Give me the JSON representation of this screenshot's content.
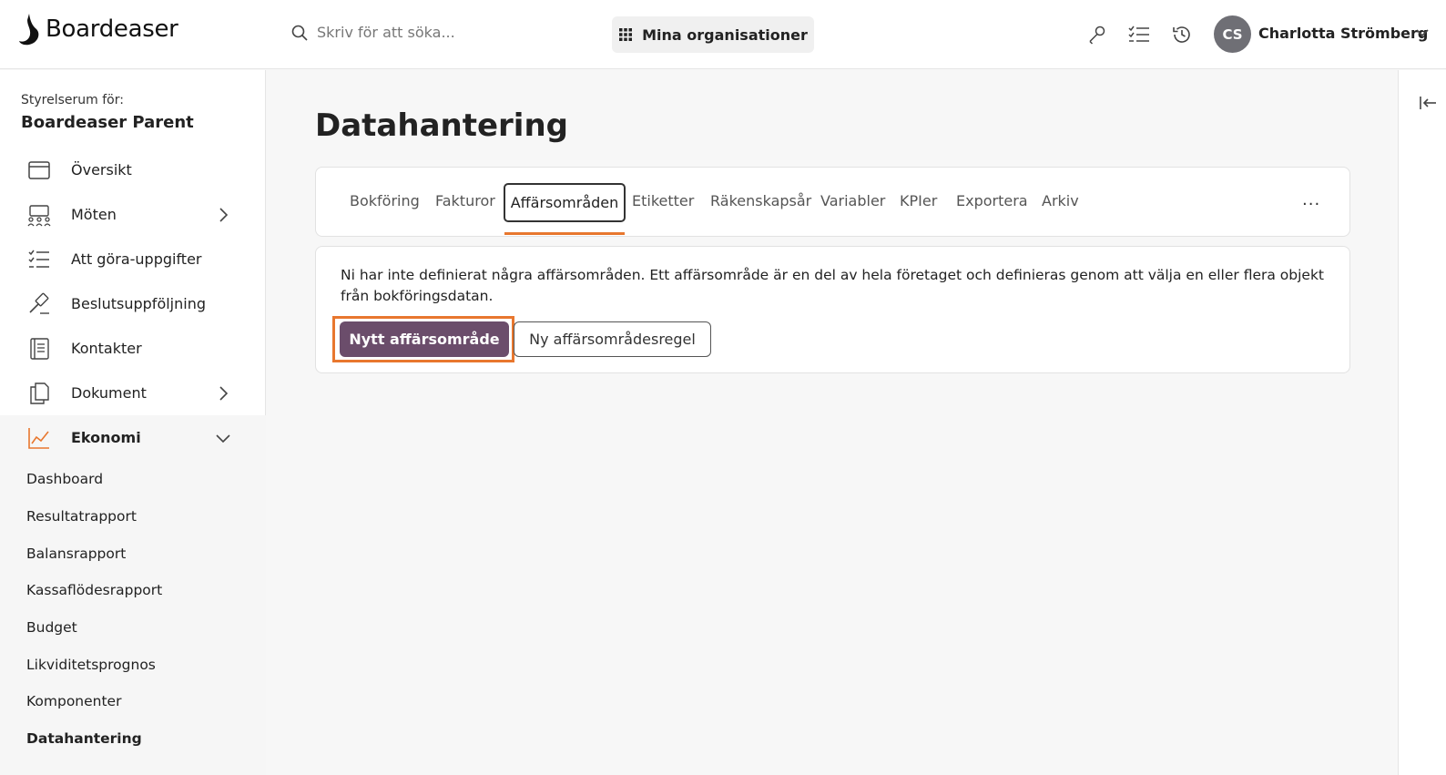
{
  "brand": {
    "name": "Boardeaser"
  },
  "header": {
    "search_placeholder": "Skriv för att söka...",
    "org_button": "Mina organisationer",
    "user_initials": "CS",
    "user_name": "Charlotta Strömberg"
  },
  "sidebar": {
    "caption": "Styrelserum för:",
    "title": "Boardeaser Parent",
    "items": [
      {
        "label": "Översikt",
        "icon": "calendar-icon"
      },
      {
        "label": "Möten",
        "icon": "people-icon",
        "expandable": true
      },
      {
        "label": "Att göra-uppgifter",
        "icon": "checklist-icon"
      },
      {
        "label": "Beslutsuppföljning",
        "icon": "gavel-icon"
      },
      {
        "label": "Kontakter",
        "icon": "contacts-book-icon"
      },
      {
        "label": "Dokument",
        "icon": "documents-icon",
        "expandable": true
      },
      {
        "label": "Ekonomi",
        "icon": "chart-line-icon",
        "expanded": true
      }
    ],
    "sub_items": [
      "Dashboard",
      "Resultatrapport",
      "Balansrapport",
      "Kassaflödesrapport",
      "Budget",
      "Likviditetsprognos",
      "Komponenter",
      "Datahantering"
    ]
  },
  "main": {
    "title": "Datahantering",
    "tabs": [
      "Bokföring",
      "Fakturor",
      "Affärsområden",
      "Etiketter",
      "Räkenskapsår",
      "Variabler",
      "KPIer",
      "Exportera",
      "Arkiv"
    ],
    "more_label": "...",
    "info_text": "Ni har inte definierat några affärsområden. Ett affärsområde är en del av hela företaget och definieras genom att välja en eller flera objekt från bokföringsdatan.",
    "primary_button": "Nytt affärsområde",
    "secondary_button": "Ny affärsområdesregel"
  },
  "colors": {
    "accent": "#e8772e",
    "primary_button": "#6b4d6b",
    "ekonomi_icon": "#e8772e"
  }
}
